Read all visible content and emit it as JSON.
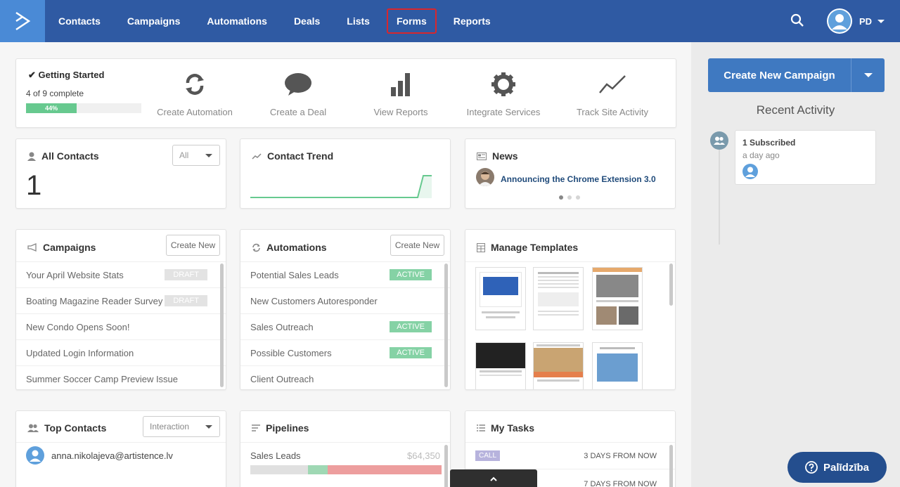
{
  "nav": {
    "items": [
      {
        "label": "Contacts"
      },
      {
        "label": "Campaigns"
      },
      {
        "label": "Automations"
      },
      {
        "label": "Deals"
      },
      {
        "label": "Lists"
      },
      {
        "label": "Forms",
        "highlighted": true
      },
      {
        "label": "Reports"
      }
    ],
    "user_initials": "PD",
    "icons": {
      "logo": "arrow-logo-icon",
      "search": "search-icon",
      "avatar": "user-avatar-icon",
      "caret": "caret-down-icon"
    }
  },
  "getting_started": {
    "title": "Getting Started",
    "progress_text": "4 of 9 complete",
    "progress_label": "44%",
    "progress_fraction": 0.44,
    "actions": [
      {
        "label": "Create Automation",
        "icon": "refresh-icon"
      },
      {
        "label": "Create a Deal",
        "icon": "chat-bubble-icon"
      },
      {
        "label": "View Reports",
        "icon": "bar-chart-icon"
      },
      {
        "label": "Integrate Services",
        "icon": "gear-icon"
      },
      {
        "label": "Track Site Activity",
        "icon": "trend-line-icon"
      }
    ]
  },
  "all_contacts": {
    "title": "All Contacts",
    "filter_value": "All",
    "count": "1"
  },
  "contact_trend": {
    "title": "Contact Trend"
  },
  "news": {
    "title": "News",
    "headline": "Announcing the Chrome Extension 3.0"
  },
  "campaigns": {
    "title": "Campaigns",
    "create_label": "Create New",
    "items": [
      {
        "name": "Your April Website Stats",
        "status": "DRAFT"
      },
      {
        "name": "Boating Magazine Reader Survey",
        "status": "DRAFT"
      },
      {
        "name": "New Condo Opens Soon!",
        "status": ""
      },
      {
        "name": "Updated Login Information",
        "status": ""
      },
      {
        "name": "Summer Soccer Camp Preview Issue",
        "status": ""
      }
    ]
  },
  "automations": {
    "title": "Automations",
    "create_label": "Create New",
    "items": [
      {
        "name": "Potential Sales Leads",
        "status": "ACTIVE"
      },
      {
        "name": "New Customers Autoresponder",
        "status": ""
      },
      {
        "name": "Sales Outreach",
        "status": "ACTIVE"
      },
      {
        "name": "Possible Customers",
        "status": "ACTIVE"
      },
      {
        "name": "Client Outreach",
        "status": ""
      }
    ]
  },
  "templates": {
    "title": "Manage Templates"
  },
  "top_contacts": {
    "title": "Top Contacts",
    "filter_value": "Interaction",
    "email": "anna.nikolajeva@artistence.lv"
  },
  "pipelines": {
    "title": "Pipelines",
    "pipeline_name": "Sales Leads",
    "value": "$64,350"
  },
  "tasks": {
    "title": "My Tasks",
    "items": [
      {
        "type": "CALL",
        "due": "3 DAYS FROM NOW"
      },
      {
        "type": "",
        "due": "7 DAYS FROM NOW"
      }
    ]
  },
  "sidebar": {
    "create_campaign_label": "Create New Campaign",
    "recent_title": "Recent Activity",
    "activity": {
      "title": "1 Subscribed",
      "time": "a day ago"
    }
  },
  "help": {
    "label": "Palīdzība"
  },
  "colors": {
    "nav": "#2f5aa3",
    "accent": "#3f79c1",
    "active": "#85d2a5",
    "draft": "#e3e3e3",
    "progress": "#67c98f"
  }
}
